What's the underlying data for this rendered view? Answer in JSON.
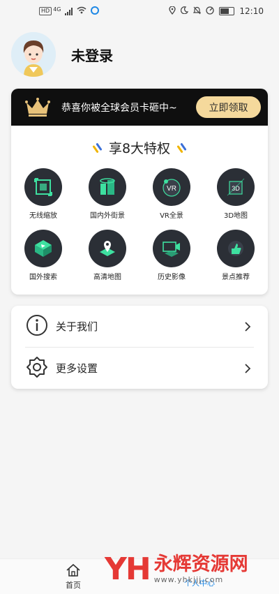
{
  "status_bar": {
    "time": "12:10",
    "network_badge": "HD",
    "network_type": "4G"
  },
  "profile": {
    "name": "未登录"
  },
  "vip_banner": {
    "text": "恭喜你被全球会员卡砸中~",
    "claim_button": "立即领取"
  },
  "perks": {
    "title": "享8大特权",
    "items": [
      {
        "label": "无线缩放",
        "icon": "zoom-icon"
      },
      {
        "label": "国内外街景",
        "icon": "streetview-icon"
      },
      {
        "label": "VR全景",
        "icon": "vr-icon"
      },
      {
        "label": "3D地图",
        "icon": "3d-map-icon"
      },
      {
        "label": "国外搜索",
        "icon": "search-location-icon"
      },
      {
        "label": "高清地图",
        "icon": "map-pin-icon"
      },
      {
        "label": "历史影像",
        "icon": "video-icon"
      },
      {
        "label": "景点推荐",
        "icon": "thumbs-up-icon"
      }
    ]
  },
  "menu": {
    "about": "关于我们",
    "settings": "更多设置"
  },
  "bottom_nav": {
    "home": "首页",
    "me": "个人中心"
  },
  "watermark": {
    "logo": "YH",
    "name": "永辉资源网",
    "url": "www.yhkjjj.com"
  },
  "colors": {
    "accent_gold": "#f5d99c",
    "banner_bg": "#0f0f0f",
    "icon_green": "#3ee0a0",
    "nav_active": "#1e88e5"
  }
}
